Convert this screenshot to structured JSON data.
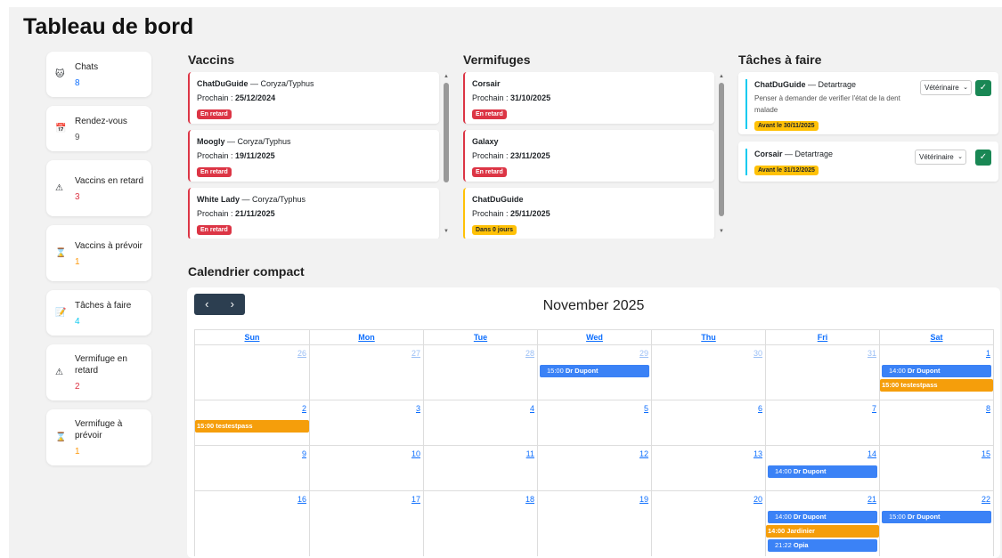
{
  "title": "Tableau de bord",
  "stats": [
    {
      "icon": "cat-face-icon",
      "glyph": "🐱",
      "label": "Chats",
      "value": "8",
      "color": "blue"
    },
    {
      "icon": "calendar-icon",
      "glyph": "📅",
      "label": "Rendez-vous",
      "value": "9",
      "color": "gray"
    },
    {
      "icon": "warning-icon",
      "glyph": "⚠",
      "label": "Vaccins en retard",
      "value": "3",
      "color": "red"
    },
    {
      "icon": "hourglass-icon",
      "glyph": "⌛",
      "label": "Vaccins à prévoir",
      "value": "1",
      "color": "orange"
    },
    {
      "icon": "memo-icon",
      "glyph": "📝",
      "label": "Tâches à faire",
      "value": "4",
      "color": "cyan"
    },
    {
      "icon": "warning-icon",
      "glyph": "⚠",
      "label": "Vermifuge en retard",
      "value": "2",
      "color": "red"
    },
    {
      "icon": "hourglass-icon",
      "glyph": "⌛",
      "label": "Vermifuge à prévoir",
      "value": "1",
      "color": "orange"
    }
  ],
  "vaccins": {
    "title": "Vaccins",
    "items": [
      {
        "name": "ChatDuGuide",
        "detail": " — Coryza/Typhus",
        "next_label": "Prochain : ",
        "next": "25/12/2024",
        "badge": "En retard",
        "status": "late"
      },
      {
        "name": "Moogly",
        "detail": " — Coryza/Typhus",
        "next_label": "Prochain : ",
        "next": "19/11/2025",
        "badge": "En retard",
        "status": "late"
      },
      {
        "name": "White Lady",
        "detail": " — Coryza/Typhus",
        "next_label": "Prochain : ",
        "next": "21/11/2025",
        "badge": "En retard",
        "status": "late"
      }
    ]
  },
  "vermifuges": {
    "title": "Vermifuges",
    "items": [
      {
        "name": "Corsair",
        "detail": "",
        "next_label": "Prochain : ",
        "next": "31/10/2025",
        "badge": "En retard",
        "status": "late"
      },
      {
        "name": "Galaxy",
        "detail": "",
        "next_label": "Prochain : ",
        "next": "23/11/2025",
        "badge": "En retard",
        "status": "late"
      },
      {
        "name": "ChatDuGuide",
        "detail": "",
        "next_label": "Prochain : ",
        "next": "25/11/2025",
        "badge": "Dans 0 jours",
        "status": "soon"
      }
    ]
  },
  "taches": {
    "title": "Tâches à faire",
    "items": [
      {
        "name": "ChatDuGuide",
        "task": " — Detartrage",
        "note": "Penser à demander de verifier l'état de la dent malade",
        "badge": "Avant le 30/11/2025",
        "assignee": "Vétérinaire"
      },
      {
        "name": "Corsair",
        "task": " — Detartrage",
        "note": "",
        "badge": "Avant le 31/12/2025",
        "assignee": "Vétérinaire"
      }
    ]
  },
  "calendar": {
    "title": "Calendrier compact",
    "prev": "‹",
    "next": "›",
    "month": "November 2025",
    "days_of_week": [
      "Sun",
      "Mon",
      "Tue",
      "Wed",
      "Thu",
      "Fri",
      "Sat"
    ],
    "weeks": [
      {
        "days": [
          {
            "n": "26",
            "other": true,
            "events": []
          },
          {
            "n": "27",
            "other": true,
            "events": []
          },
          {
            "n": "28",
            "other": true,
            "events": []
          },
          {
            "n": "29",
            "other": true,
            "events": [
              {
                "time": "15:00",
                "label": "Dr Dupont",
                "color": "blue"
              }
            ]
          },
          {
            "n": "30",
            "other": true,
            "events": []
          },
          {
            "n": "31",
            "other": true,
            "events": []
          },
          {
            "n": "1",
            "other": false,
            "events": [
              {
                "time": "14:00",
                "label": "Dr Dupont",
                "color": "blue"
              },
              {
                "time": "15:00",
                "label": "testestpass",
                "color": "orange"
              }
            ]
          }
        ]
      },
      {
        "days": [
          {
            "n": "2",
            "other": false,
            "events": [
              {
                "time": "15:00",
                "label": "testestpass",
                "color": "orange"
              }
            ]
          },
          {
            "n": "3",
            "other": false,
            "events": []
          },
          {
            "n": "4",
            "other": false,
            "events": []
          },
          {
            "n": "5",
            "other": false,
            "events": []
          },
          {
            "n": "6",
            "other": false,
            "events": []
          },
          {
            "n": "7",
            "other": false,
            "events": []
          },
          {
            "n": "8",
            "other": false,
            "events": []
          }
        ]
      },
      {
        "days": [
          {
            "n": "9",
            "other": false,
            "events": []
          },
          {
            "n": "10",
            "other": false,
            "events": []
          },
          {
            "n": "11",
            "other": false,
            "events": []
          },
          {
            "n": "12",
            "other": false,
            "events": []
          },
          {
            "n": "13",
            "other": false,
            "events": []
          },
          {
            "n": "14",
            "other": false,
            "events": [
              {
                "time": "14:00",
                "label": "Dr Dupont",
                "color": "blue"
              }
            ]
          },
          {
            "n": "15",
            "other": false,
            "events": []
          }
        ]
      },
      {
        "days": [
          {
            "n": "16",
            "other": false,
            "events": []
          },
          {
            "n": "17",
            "other": false,
            "events": []
          },
          {
            "n": "18",
            "other": false,
            "events": []
          },
          {
            "n": "19",
            "other": false,
            "events": []
          },
          {
            "n": "20",
            "other": false,
            "events": []
          },
          {
            "n": "21",
            "other": false,
            "events": [
              {
                "time": "14:00",
                "label": "Dr Dupont",
                "color": "blue"
              },
              {
                "time": "14:00",
                "label": "Jardinier",
                "color": "orange"
              },
              {
                "time": "21:22",
                "label": "Opia",
                "color": "blue"
              }
            ]
          },
          {
            "n": "22",
            "other": false,
            "events": [
              {
                "time": "15:00",
                "label": "Dr Dupont",
                "color": "blue"
              }
            ]
          }
        ]
      }
    ]
  }
}
